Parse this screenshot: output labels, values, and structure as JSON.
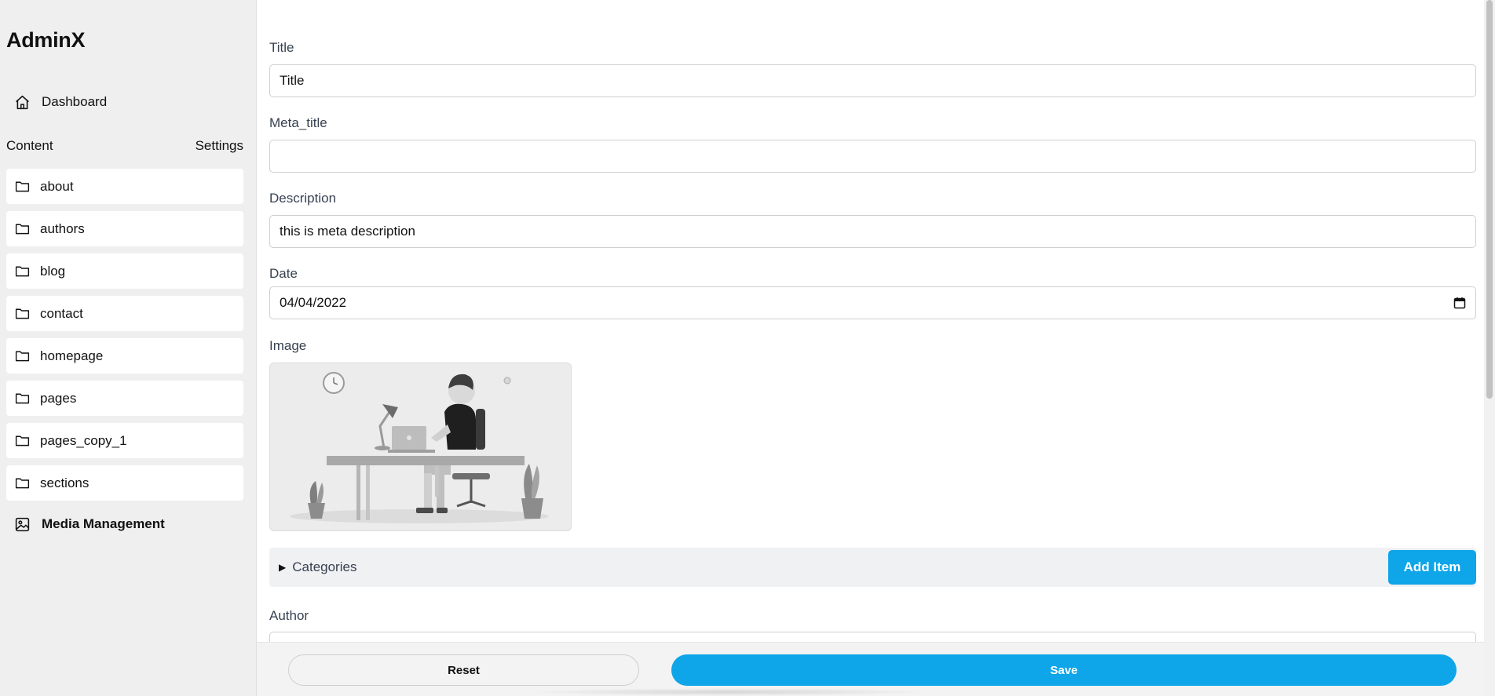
{
  "app": {
    "brand": "AdminX"
  },
  "sidebar": {
    "dashboard_label": "Dashboard",
    "content_heading": "Content",
    "settings_label": "Settings",
    "folders": [
      {
        "label": "about"
      },
      {
        "label": "authors"
      },
      {
        "label": "blog"
      },
      {
        "label": "contact"
      },
      {
        "label": "homepage"
      },
      {
        "label": "pages"
      },
      {
        "label": "pages_copy_1"
      },
      {
        "label": "sections"
      }
    ],
    "media_label": "Media Management"
  },
  "form": {
    "title": {
      "label": "Title",
      "value": "Title"
    },
    "meta_title": {
      "label": "Meta_title",
      "value": ""
    },
    "description": {
      "label": "Description",
      "value": "this is meta description"
    },
    "date": {
      "label": "Date",
      "value": "04/04/2022"
    },
    "image": {
      "label": "Image"
    },
    "categories": {
      "label": "Categories",
      "add_button": "Add Item"
    },
    "author": {
      "label": "Author"
    }
  },
  "actions": {
    "reset_label": "Reset",
    "save_label": "Save"
  },
  "colors": {
    "accent": "#0ea5e9",
    "sidebar_bg": "#efefef",
    "top_accent": "#f9a8d4"
  }
}
